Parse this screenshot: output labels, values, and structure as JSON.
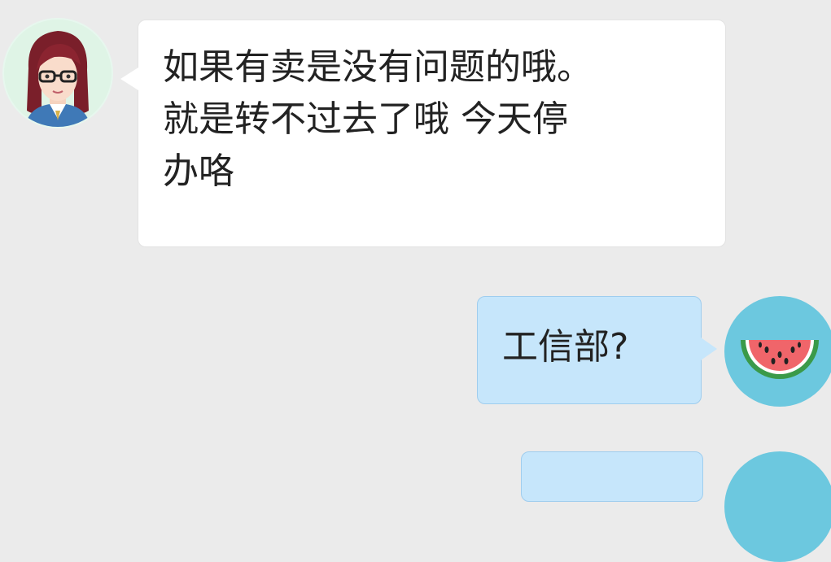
{
  "conversation": {
    "messages": [
      {
        "sender": "agent",
        "lines": [
          "如果有卖是没有问题的哦。",
          "就是转不过去了哦 今天停",
          "办咯"
        ]
      },
      {
        "sender": "me",
        "text": "工信部?"
      }
    ]
  },
  "icons": {
    "agent_avatar": "cartoon-woman-with-glasses-avatar",
    "me_avatar": "watermelon-slice-avatar"
  },
  "colors": {
    "background": "#ebebeb",
    "incoming_bubble": "#ffffff",
    "outgoing_bubble": "#c6e6fb",
    "outgoing_border": "#9fcdee",
    "me_avatar_bg": "#6cc8df",
    "agent_avatar_bg": "#dff4e6"
  }
}
